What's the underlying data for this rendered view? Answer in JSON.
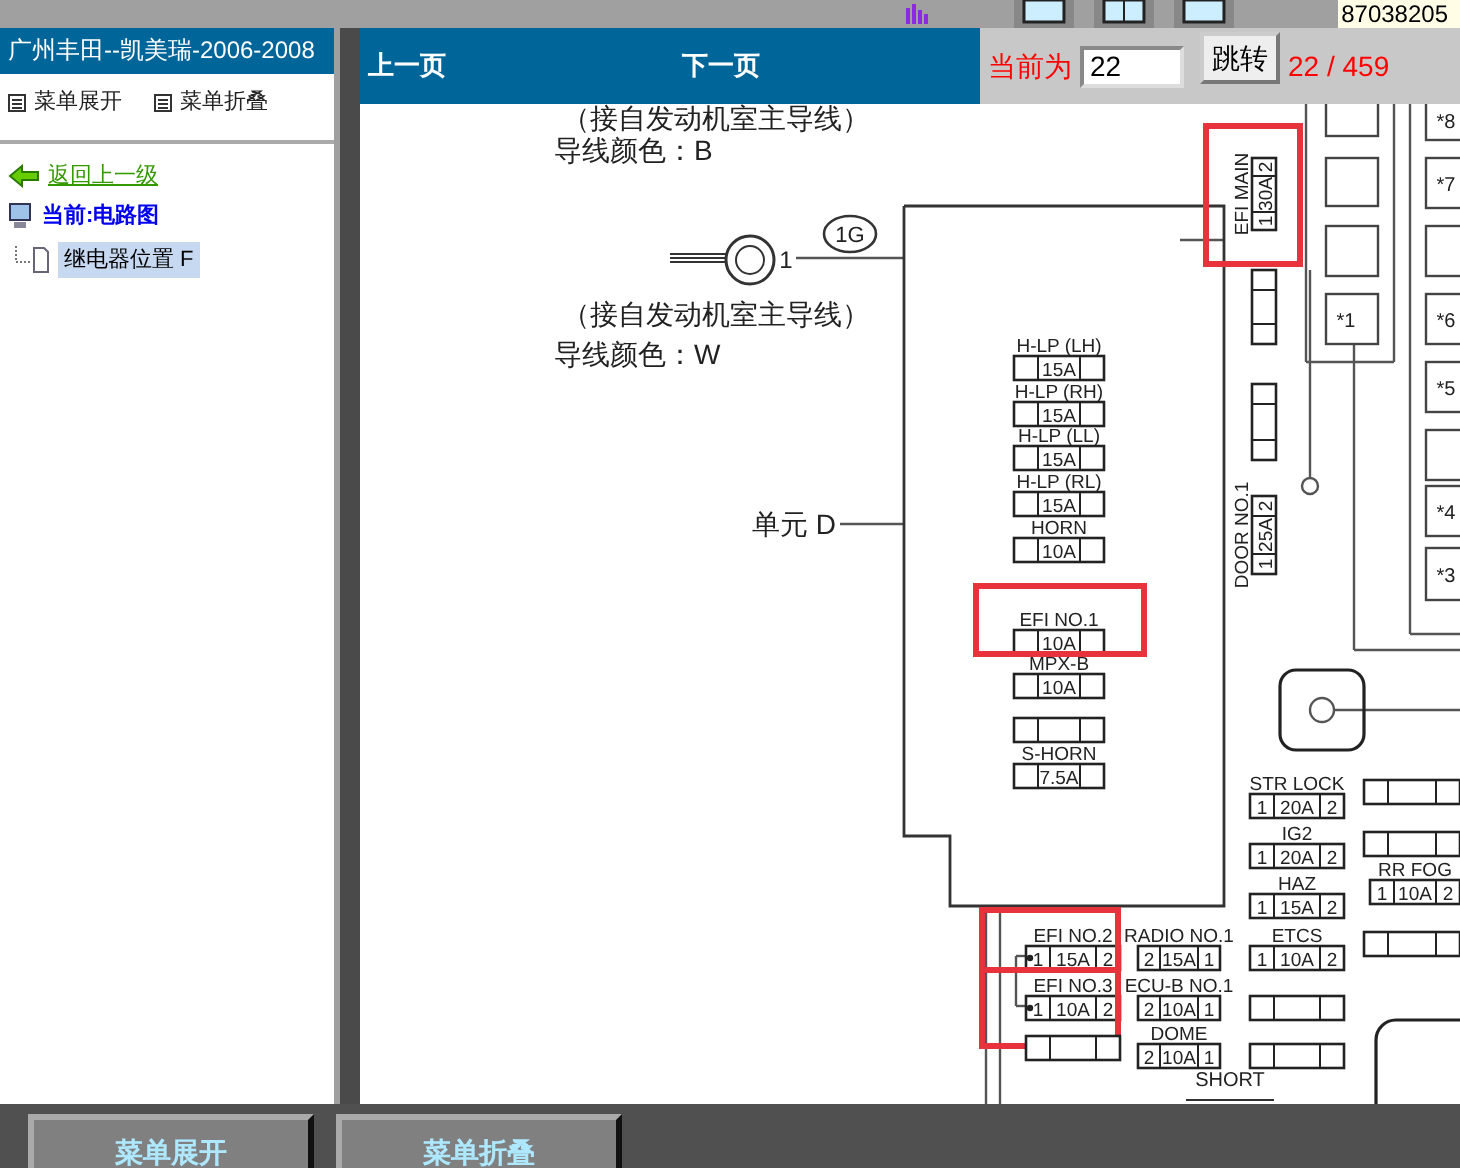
{
  "top_strip": {
    "phone": "87038205"
  },
  "sidebar": {
    "title": "广州丰田--凯美瑞-2006-2008",
    "menu_links": [
      "菜单展开",
      "菜单折叠"
    ],
    "back_link": "返回上一级",
    "current": "当前:电路图",
    "tree": [
      {
        "label": "继电器位置 F",
        "selected": true
      }
    ]
  },
  "toolbar": {
    "prev": "上一页",
    "next": "下一页",
    "page_label": "当前为",
    "page_value": "22",
    "go_button": "跳转",
    "page_count": "22 / 459"
  },
  "diagram": {
    "notes": [
      "（接自发动机室主导线）",
      "导线颜色：B",
      "（接自发动机室主导线）",
      "导线颜色：W"
    ],
    "terminal_number": "1",
    "connector_code": "1G",
    "unit_label": "单元 D",
    "short_label": "SHORT",
    "fuses": [
      {
        "kind": "horizontal",
        "name": "H-LP (LH)",
        "rating": "15A",
        "highlighted": false
      },
      {
        "kind": "horizontal",
        "name": "H-LP (RH)",
        "rating": "15A",
        "highlighted": false
      },
      {
        "kind": "horizontal",
        "name": "H-LP (LL)",
        "rating": "15A",
        "highlighted": false
      },
      {
        "kind": "horizontal",
        "name": "H-LP (RL)",
        "rating": "15A",
        "highlighted": false
      },
      {
        "kind": "horizontal",
        "name": "HORN",
        "rating": "10A",
        "highlighted": false
      },
      {
        "kind": "horizontal",
        "name": "EFI NO.1",
        "rating": "10A",
        "highlighted": true
      },
      {
        "kind": "horizontal",
        "name": "MPX-B",
        "rating": "10A",
        "highlighted": false
      },
      {
        "kind": "horizontal",
        "highlighted": false
      },
      {
        "kind": "horizontal",
        "name": "S-HORN",
        "rating": "7.5A",
        "highlighted": false
      },
      {
        "kind": "horizontal",
        "name": "EFI NO.2",
        "rating": "15A",
        "pins": [
          "1",
          "2"
        ],
        "highlighted": true
      },
      {
        "kind": "horizontal",
        "name": "EFI NO.3",
        "rating": "10A",
        "pins": [
          "1",
          "2"
        ],
        "highlighted": true
      },
      {
        "kind": "horizontal",
        "highlighted": false
      },
      {
        "kind": "horizontal",
        "name": "RADIO NO.1",
        "rating": "15A",
        "pins": [
          "2",
          "1"
        ],
        "highlighted": false
      },
      {
        "kind": "horizontal",
        "name": "ECU-B NO.1",
        "rating": "10A",
        "pins": [
          "2",
          "1"
        ],
        "highlighted": false
      },
      {
        "kind": "horizontal",
        "name": "DOME",
        "rating": "10A",
        "pins": [
          "2",
          "1"
        ],
        "highlighted": false
      },
      {
        "kind": "horizontal",
        "name": "STR LOCK",
        "rating": "20A",
        "pins": [
          "1",
          "2"
        ],
        "highlighted": false
      },
      {
        "kind": "horizontal",
        "name": "IG2",
        "rating": "20A",
        "pins": [
          "1",
          "2"
        ],
        "highlighted": false
      },
      {
        "kind": "horizontal",
        "name": "HAZ",
        "rating": "15A",
        "pins": [
          "1",
          "2"
        ],
        "highlighted": false
      },
      {
        "kind": "horizontal",
        "name": "ETCS",
        "rating": "10A",
        "pins": [
          "1",
          "2"
        ],
        "highlighted": false
      },
      {
        "kind": "horizontal",
        "highlighted": false
      },
      {
        "kind": "horizontal",
        "highlighted": false
      },
      {
        "kind": "horizontal",
        "highlighted": false
      },
      {
        "kind": "horizontal",
        "highlighted": false
      },
      {
        "kind": "horizontal",
        "name": "RR FOG",
        "rating": "10A",
        "pins": [
          "1",
          "2"
        ],
        "highlighted": false
      },
      {
        "kind": "horizontal",
        "highlighted": false
      },
      {
        "kind": "vertical",
        "name": "EFI MAIN",
        "rating": "30A",
        "pins": [
          "1",
          "2"
        ],
        "highlighted": true
      },
      {
        "kind": "vertical",
        "highlighted": false
      },
      {
        "kind": "vertical",
        "highlighted": false
      },
      {
        "kind": "vertical",
        "name": "DOOR NO.1",
        "rating": "25A",
        "pins": [
          "1",
          "2"
        ],
        "highlighted": false
      }
    ],
    "relays": [
      {
        "kind": "blank"
      },
      {
        "kind": "blank"
      },
      {
        "kind": "blank"
      },
      {
        "kind": "labeled",
        "label": "*1"
      },
      {
        "kind": "labeled",
        "label": "*8"
      },
      {
        "kind": "labeled",
        "label": "*7"
      },
      {
        "kind": "blank"
      },
      {
        "kind": "labeled",
        "label": "*6"
      },
      {
        "kind": "labeled",
        "label": "*5"
      },
      {
        "kind": "blank"
      },
      {
        "kind": "labeled",
        "label": "*4"
      },
      {
        "kind": "labeled",
        "label": "*3"
      }
    ]
  },
  "bottom_buttons": [
    "菜单展开",
    "菜单折叠"
  ]
}
